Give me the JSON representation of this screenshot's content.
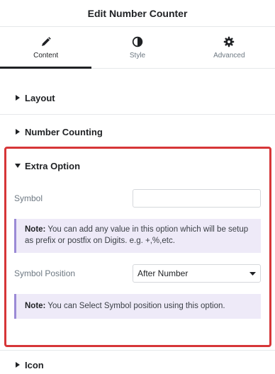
{
  "header": {
    "title": "Edit Number Counter"
  },
  "tabs": [
    {
      "label": "Content",
      "icon": "pencil-icon",
      "active": true
    },
    {
      "label": "Style",
      "icon": "half-circle-icon",
      "active": false
    },
    {
      "label": "Advanced",
      "icon": "gear-icon",
      "active": false
    }
  ],
  "sections": {
    "layout": "Layout",
    "number_counting": "Number Counting",
    "extra_option": "Extra Option",
    "icon": "Icon"
  },
  "extra_option": {
    "symbol_label": "Symbol",
    "symbol_value": "",
    "note1_prefix": "Note:",
    "note1_text": " You can add any value in this option which will be setup as prefix or postfix on Digits. e.g. +,%,etc.",
    "symbol_position_label": "Symbol Position",
    "symbol_position_value": "After Number",
    "note2_prefix": "Note:",
    "note2_text": " You can Select Symbol position using this option."
  },
  "colors": {
    "highlight_border": "#d63638",
    "note_bg": "#eeeaf8",
    "note_border": "#9b8ad6"
  }
}
